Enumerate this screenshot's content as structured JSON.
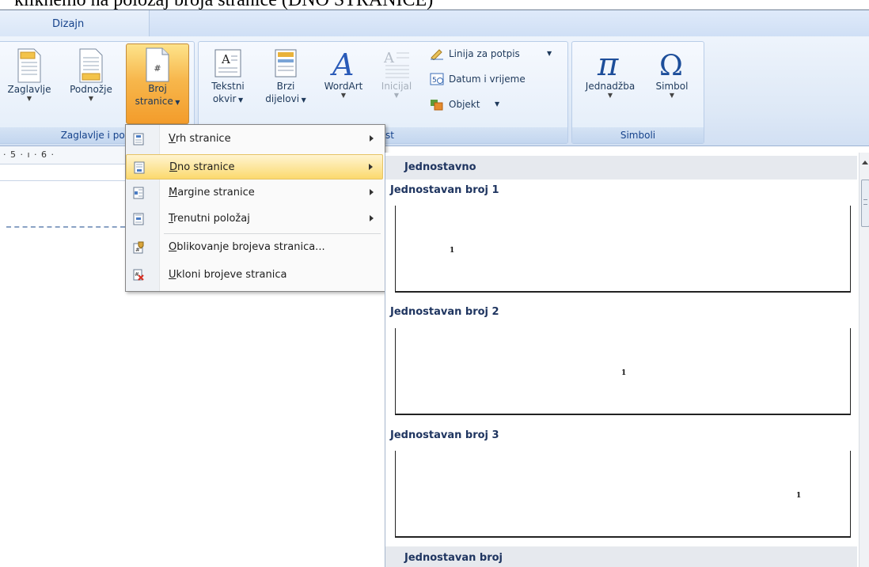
{
  "caption": "kliknemo na položaj broja stranice (DNO STRANICE)",
  "ribbon": {
    "tab": "Dizajn",
    "groups": {
      "header_footer": {
        "label": "Zaglavlje i pod",
        "zaglavlje": "Zaglavlje",
        "podnozje": "Podnožje",
        "broj_line1": "Broj",
        "broj_line2": "stranice"
      },
      "text": {
        "label": "st",
        "tekstni_line1": "Tekstni",
        "tekstni_line2": "okvir",
        "brzi_line1": "Brzi",
        "brzi_line2": "dijelovi",
        "wordart": "WordArt",
        "inicijal": "Inicijal",
        "linija": "Linija za potpis",
        "datum": "Datum i vrijeme",
        "objekt": "Objekt"
      },
      "symbols": {
        "label": "Simboli",
        "jednadzba": "Jednadžba",
        "simbol": "Simbol"
      }
    }
  },
  "ruler": {
    "text": "· 5 · ı · 6 ·"
  },
  "menu": {
    "items": [
      {
        "label": "Vrh stranice",
        "accel": "V"
      },
      {
        "label": "Dno stranice",
        "accel": "D"
      },
      {
        "label": "Margine stranice",
        "accel": "M"
      },
      {
        "label": "Trenutni položaj",
        "accel": "T"
      },
      {
        "label": "Oblikovanje brojeva stranica...",
        "accel": "O"
      },
      {
        "label": "Ukloni brojeve stranica",
        "accel": "U"
      }
    ]
  },
  "gallery": {
    "header": "Jednostavno",
    "entries": [
      {
        "title": "Jednostavan broj 1",
        "number": "1"
      },
      {
        "title": "Jednostavan broj 2",
        "number": "1"
      },
      {
        "title": "Jednostavan broj 3",
        "number": "1"
      }
    ],
    "footer_header": "Jednostavan broj"
  }
}
